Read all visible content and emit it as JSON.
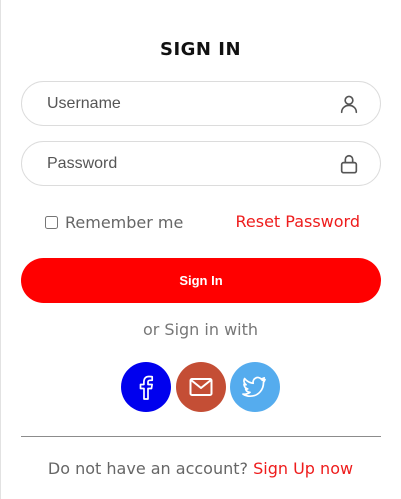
{
  "form": {
    "title": "SIGN IN",
    "username": {
      "placeholder": "Username",
      "value": ""
    },
    "password": {
      "placeholder": "Password",
      "value": ""
    },
    "remember_label": "Remember me",
    "remember_checked": false,
    "reset_link": "Reset Password",
    "signin_label": "Sign In"
  },
  "social": {
    "label": "or Sign in with",
    "buttons": [
      {
        "icon": "facebook-icon",
        "color": "#0000ee"
      },
      {
        "icon": "mail-icon",
        "color": "#c44e35"
      },
      {
        "icon": "twitter-icon",
        "color": "#55acee"
      }
    ]
  },
  "footer": {
    "text": "Do not have an account?",
    "signup_link": "Sign Up now"
  },
  "colors": {
    "accent": "#ff0000",
    "link": "#ee1c1c",
    "facebook": "#0000ee",
    "mail": "#c44e35",
    "twitter": "#55acee"
  }
}
